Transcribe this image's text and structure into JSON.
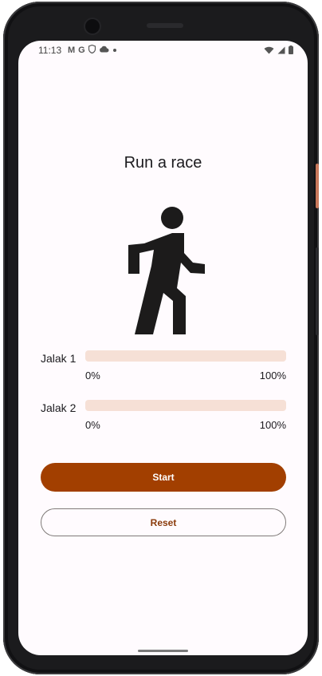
{
  "status_bar": {
    "time": "11:13",
    "left_icons": [
      "gmail-icon",
      "google-icon",
      "shield-icon",
      "cloud-icon",
      "dot-icon"
    ],
    "right_icons": [
      "wifi-icon",
      "signal-icon",
      "battery-icon"
    ]
  },
  "screen": {
    "title": "Run a race",
    "illustration": "walking-person-icon"
  },
  "racers": [
    {
      "name": "Jalak 1",
      "progress": 0,
      "min_label": "0%",
      "max_label": "100%"
    },
    {
      "name": "Jalak 2",
      "progress": 0,
      "min_label": "0%",
      "max_label": "100%"
    }
  ],
  "actions": {
    "start_label": "Start",
    "reset_label": "Reset"
  },
  "colors": {
    "primary": "#a23f00",
    "track": "#f6e0d6",
    "background": "#fffbfe"
  }
}
